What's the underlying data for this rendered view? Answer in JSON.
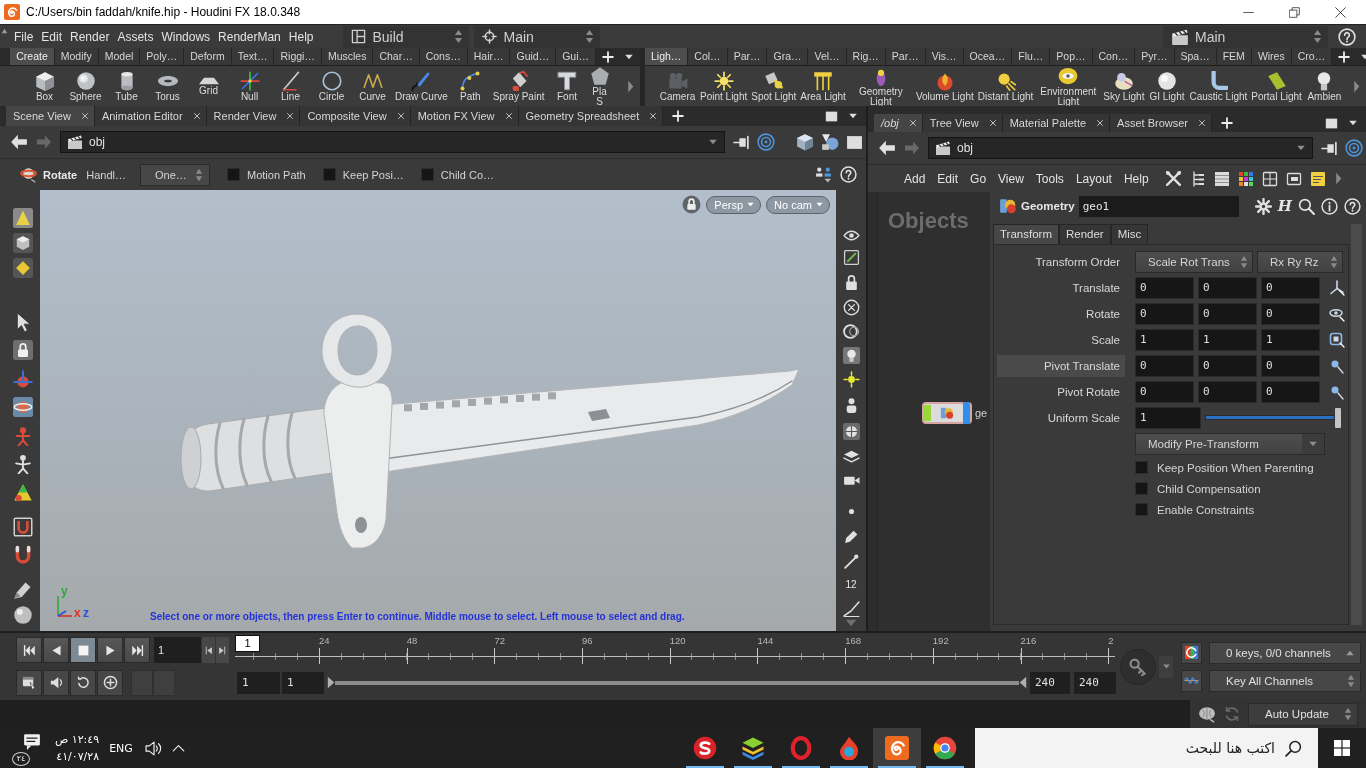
{
  "window": {
    "title": "C:/Users/bin faddah/knife.hip - Houdini FX 18.0.348"
  },
  "menu_bar": {
    "items": [
      "File",
      "Edit",
      "Render",
      "Assets",
      "Windows",
      "RenderMan",
      "Help"
    ],
    "desktop": "Build",
    "context": "Main",
    "right_context": "Main"
  },
  "shelf_left": {
    "tabs": [
      {
        "label": "Create",
        "selected": true
      },
      {
        "label": "Modify",
        "selected": false
      },
      {
        "label": "Model",
        "selected": false
      },
      {
        "label": "Poly…",
        "selected": false
      },
      {
        "label": "Deform",
        "selected": false
      },
      {
        "label": "Text…",
        "selected": false
      },
      {
        "label": "Riggi…",
        "selected": false
      },
      {
        "label": "Muscles",
        "selected": false
      },
      {
        "label": "Char…",
        "selected": false
      },
      {
        "label": "Cons…",
        "selected": false
      },
      {
        "label": "Hair…",
        "selected": false
      },
      {
        "label": "Guid…",
        "selected": false
      },
      {
        "label": "Gui…",
        "selected": false
      }
    ],
    "tools": [
      "Box",
      "Sphere",
      "Tube",
      "Torus",
      "Grid",
      "Null",
      "Line",
      "Circle",
      "Curve",
      "Draw Curve",
      "Path",
      "Spray Paint",
      "Font",
      "Pla S"
    ]
  },
  "shelf_right": {
    "tabs": [
      {
        "label": "Ligh…",
        "selected": true
      },
      {
        "label": "Col…",
        "selected": false
      },
      {
        "label": "Par…",
        "selected": false
      },
      {
        "label": "Gra…",
        "selected": false
      },
      {
        "label": "Vel…",
        "selected": false
      },
      {
        "label": "Rig…",
        "selected": false
      },
      {
        "label": "Par…",
        "selected": false
      },
      {
        "label": "Vis…",
        "selected": false
      },
      {
        "label": "Ocea…",
        "selected": false
      },
      {
        "label": "Flu…",
        "selected": false
      },
      {
        "label": "Pop…",
        "selected": false
      },
      {
        "label": "Con…",
        "selected": false
      },
      {
        "label": "Pyr…",
        "selected": false
      },
      {
        "label": "Spa…",
        "selected": false
      },
      {
        "label": "FEM",
        "selected": false
      },
      {
        "label": "Wires",
        "selected": false
      },
      {
        "label": "Cro…",
        "selected": false
      }
    ],
    "tools": [
      "Camera",
      "Point Light",
      "Spot Light",
      "Area Light",
      "Geometry Light",
      "Volume Light",
      "Distant Light",
      "Environment Light",
      "Sky Light",
      "GI Light",
      "Caustic Light",
      "Portal Light",
      "Ambien"
    ]
  },
  "scene_pane": {
    "tabs": [
      {
        "label": "Scene View",
        "selected": true
      },
      {
        "label": "Animation Editor",
        "selected": false
      },
      {
        "label": "Render View",
        "selected": false
      },
      {
        "label": "Composite View",
        "selected": false
      },
      {
        "label": "Motion FX View",
        "selected": false
      },
      {
        "label": "Geometry Spreadsheet",
        "selected": false
      }
    ],
    "path": "obj",
    "tool": "Rotate",
    "handle": "Handl…",
    "mode": "One…",
    "options": [
      {
        "label": "Motion Path",
        "checked": false
      },
      {
        "label": "Keep Posi…",
        "checked": false
      },
      {
        "label": "Child Co…",
        "checked": false
      }
    ],
    "view": "Persp",
    "camera": "No cam",
    "toolbar_label": "12",
    "axes": [
      {
        "label": "y",
        "color": "#2fa83a"
      },
      {
        "label": "x",
        "color": "#d8332a"
      },
      {
        "label": "z",
        "color": "#2a4fd8"
      }
    ],
    "prompt": "Select one or more objects, then press Enter to continue. Middle mouse to select. Left mouse to select and drag."
  },
  "network_pane": {
    "tabs": [
      {
        "label": "/obj",
        "selected": true
      },
      {
        "label": "Tree View",
        "selected": false
      },
      {
        "label": "Material Palette",
        "selected": false
      },
      {
        "label": "Asset Browser",
        "selected": false
      }
    ],
    "path": "obj",
    "menus": [
      "Add",
      "Edit",
      "Go",
      "View",
      "Tools",
      "Layout",
      "Help"
    ],
    "context": "Objects",
    "node_label": "ge"
  },
  "parameters": {
    "type": "Geometry",
    "name": "geo1",
    "glyph_button": "H",
    "tabs": [
      {
        "label": "Transform",
        "selected": true
      },
      {
        "label": "Render",
        "selected": false
      },
      {
        "label": "Misc",
        "selected": false
      }
    ],
    "rows": [
      {
        "kind": "menus",
        "label": "Transform Order",
        "values": [
          "Scale Rot Trans",
          "Rx Ry Rz"
        ]
      },
      {
        "kind": "vector",
        "label": "Translate",
        "values": [
          "0",
          "0",
          "0"
        ],
        "highlighted": false
      },
      {
        "kind": "vector",
        "label": "Rotate",
        "values": [
          "0",
          "0",
          "0"
        ],
        "highlighted": false
      },
      {
        "kind": "vector",
        "label": "Scale",
        "values": [
          "1",
          "1",
          "1"
        ],
        "highlighted": false
      },
      {
        "kind": "vector",
        "label": "Pivot Translate",
        "values": [
          "0",
          "0",
          "0"
        ],
        "highlighted": true
      },
      {
        "kind": "vector",
        "label": "Pivot Rotate",
        "values": [
          "0",
          "0",
          "0"
        ],
        "highlighted": false
      },
      {
        "kind": "slider",
        "label": "Uniform Scale",
        "value": "1",
        "level": 1
      },
      {
        "kind": "dropdown",
        "value": "Modify Pre-Transform"
      },
      {
        "kind": "checkbox",
        "label": "Keep Position When Parenting",
        "checked": false
      },
      {
        "kind": "checkbox",
        "label": "Child Compensation",
        "checked": false
      },
      {
        "kind": "checkbox",
        "label": "Enable Constraints",
        "checked": false
      }
    ]
  },
  "timeline": {
    "buttons": [
      {
        "kind": "first",
        "selected": false
      },
      {
        "kind": "reverse",
        "selected": false
      },
      {
        "kind": "stop",
        "selected": true
      },
      {
        "kind": "play",
        "selected": false
      },
      {
        "kind": "last",
        "selected": false
      }
    ],
    "frame": "1",
    "marker": "1",
    "ticks": [
      "24",
      "48",
      "72",
      "96",
      "120",
      "144",
      "168",
      "192",
      "216",
      "2"
    ],
    "keys_info": "0 keys, 0/0 channels",
    "key_mode": "Key All Channels",
    "range": [
      "1",
      "1",
      "240",
      "240"
    ],
    "range_bar": {
      "level": 1
    }
  },
  "status_bar": {
    "update_mode": "Auto Update"
  },
  "taskbar": {
    "notifications": "٢٤",
    "time": "١٢:٤٩ ص",
    "date": "٤١/٠٧/٢٨",
    "language": "ENG",
    "apps": [
      {
        "kind": "s-badge",
        "selected": false
      },
      {
        "kind": "layers",
        "selected": false
      },
      {
        "kind": "ring",
        "selected": false
      },
      {
        "kind": "flame",
        "selected": false
      },
      {
        "kind": "spiral",
        "selected": true
      },
      {
        "kind": "ball",
        "selected": false
      }
    ],
    "search_placeholder": "اكتب هنا للبحث"
  }
}
